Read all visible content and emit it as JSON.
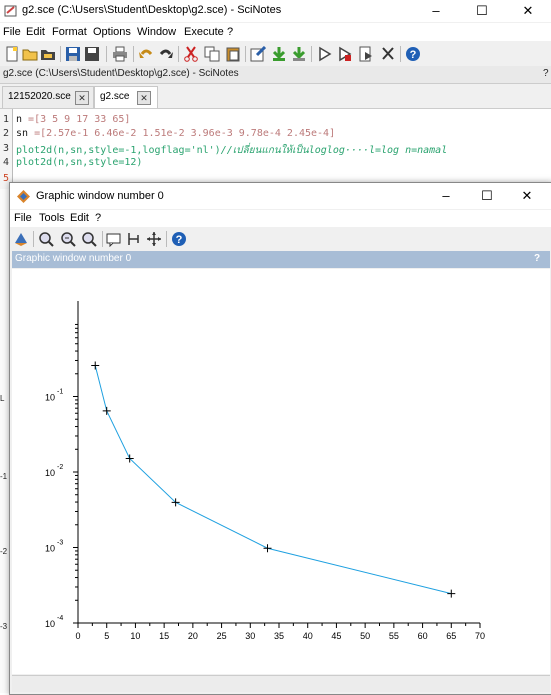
{
  "window": {
    "title": "g2.sce (C:\\Users\\Student\\Desktop\\g2.sce) - SciNotes",
    "minimize": "–",
    "maximize": "☐",
    "close": "✕"
  },
  "menu": [
    "File",
    "Edit",
    "Format",
    "Options",
    "Window",
    "Execute",
    "?"
  ],
  "toolbar_icons": [
    "new-file-icon",
    "open-file-icon",
    "open-folder-icon",
    "save-icon",
    "save-as-icon",
    "print-icon",
    "undo-icon",
    "redo-icon",
    "cut-icon",
    "copy-icon",
    "paste-icon",
    "preferences-icon",
    "save-execute-icon",
    "load-icon",
    "run-icon",
    "run-selection-icon",
    "run-file-icon",
    "cut-tool-icon",
    "help-icon"
  ],
  "pathbar": {
    "text": "g2.sce (C:\\Users\\Student\\Desktop\\g2.sce) - SciNotes",
    "help": "?"
  },
  "tabs": [
    {
      "label": "12152020.sce",
      "close": "✕"
    },
    {
      "label": "g2.sce",
      "close": "✕"
    }
  ],
  "editor": {
    "line_numbers": [
      "1",
      "2",
      "3",
      "4",
      "5"
    ],
    "line1": {
      "a": "n",
      "b": " =",
      "c": "[3 5 9 17 33 65]"
    },
    "line2": {
      "a": "sn",
      "b": " =",
      "c": "[2.57e-1 6.46e-2 1.51e-2 3.96e-3 9.78e-4 2.45e-4]"
    },
    "line3": {
      "a": "plot2d(n,sn,style=-1,logflag='nl')",
      "b": "//เปลี่ยนแกนให้เป็นloglog····l=log n=namal"
    },
    "line4": {
      "a": "plot2d(n,sn,style=12)"
    },
    "line5": {
      "a": ""
    }
  },
  "left_fragments": [
    "L",
    "-1",
    "-2",
    "-3"
  ],
  "graphic": {
    "title": "Graphic window number 0",
    "menu": [
      "File",
      "Tools",
      "Edit",
      "?"
    ],
    "tool_icons": [
      "rotate-icon",
      "zoom-in-icon",
      "zoom-out-icon",
      "zoom-fit-icon",
      "datatip-icon",
      "select-icon",
      "move-icon",
      "help-icon"
    ],
    "header": "Graphic window number 0",
    "header_help": "?"
  },
  "chart_data": {
    "type": "line",
    "x": [
      3,
      5,
      9,
      17,
      33,
      65
    ],
    "series": [
      {
        "values": [
          0.257,
          0.0646,
          0.0151,
          0.00396,
          0.000978,
          0.000245
        ],
        "color": "#1ea0e0",
        "marker": "+"
      }
    ],
    "xlim": [
      0,
      70
    ],
    "ylim_log10": [
      -4,
      0
    ],
    "ylog": true,
    "xticks": [
      "0",
      "5",
      "10",
      "15",
      "20",
      "25",
      "30",
      "35",
      "40",
      "45",
      "50",
      "55",
      "60",
      "65",
      "70"
    ],
    "yticks": [
      {
        "base": "10",
        "exp": "-1"
      },
      {
        "base": "10",
        "exp": "-2"
      },
      {
        "base": "10",
        "exp": "-3"
      },
      {
        "base": "10",
        "exp": "-4"
      }
    ],
    "grid": false
  }
}
